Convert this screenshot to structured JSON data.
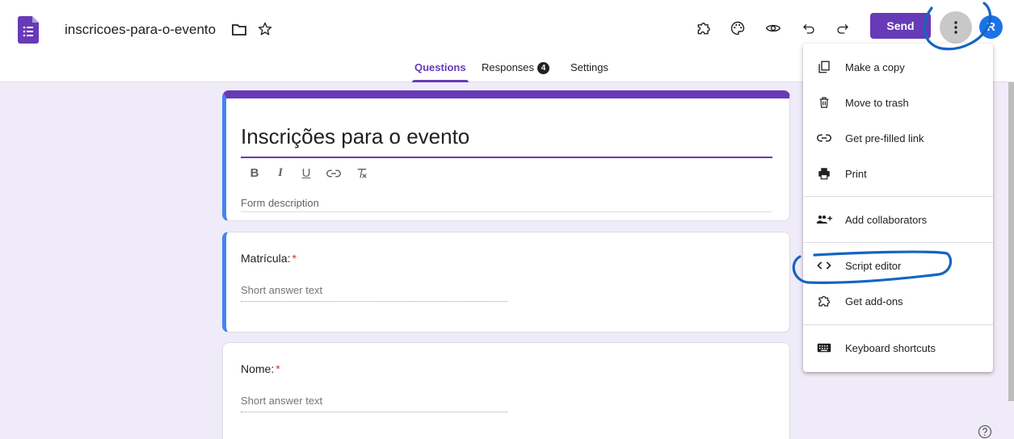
{
  "header": {
    "doc_title": "inscricoes-para-o-evento",
    "send_label": "Send",
    "avatar_initial": "R"
  },
  "tabs": [
    {
      "label": "Questions",
      "active": true
    },
    {
      "label": "Responses",
      "badge": "4"
    },
    {
      "label": "Settings"
    }
  ],
  "form": {
    "title": "Inscrições para o evento",
    "description_placeholder": "Form description",
    "format_buttons": [
      "B",
      "I",
      "U"
    ]
  },
  "questions": [
    {
      "label": "Matrícula:",
      "required_mark": "*",
      "hint": "Short answer text"
    },
    {
      "label": "Nome:",
      "required_mark": "*",
      "hint": "Short answer text"
    }
  ],
  "menu": {
    "items": [
      {
        "label": "Make a copy",
        "icon": "copy-icon"
      },
      {
        "label": "Move to trash",
        "icon": "trash-icon"
      },
      {
        "label": "Get pre-filled link",
        "icon": "link-icon"
      },
      {
        "label": "Print",
        "icon": "print-icon"
      },
      {
        "label": "Add collaborators",
        "icon": "add-people-icon"
      },
      {
        "label": "Script editor",
        "icon": "code-icon"
      },
      {
        "label": "Get add-ons",
        "icon": "puzzle-icon"
      },
      {
        "label": "Keyboard shortcuts",
        "icon": "keyboard-icon"
      }
    ]
  },
  "colors": {
    "accent": "#673ab7",
    "background": "#f0ebf8",
    "active_question": "#4285f4",
    "annotation": "#1565c0"
  }
}
